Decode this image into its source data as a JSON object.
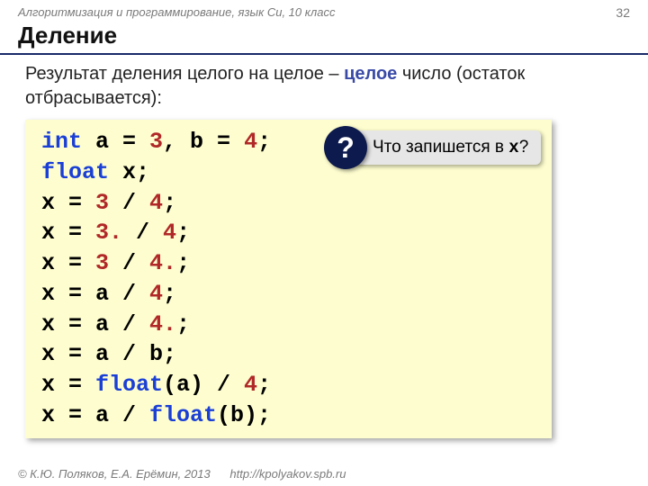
{
  "header": {
    "course": "Алгоритмизация и программирование, язык Си, 10 класс",
    "page": "32"
  },
  "title": "Деление",
  "description": {
    "pre": "Результат деления целого на целое – ",
    "em": "целое",
    "post": " число (остаток отбрасывается):"
  },
  "code": {
    "l1_kw": "int",
    "l1_a": " a = ",
    "l1_n1": "3",
    "l1_c": ", b = ",
    "l1_n2": "4",
    "l1_e": ";",
    "l2_kw": "float",
    "l2_r": " x;",
    "l3_a": "x = ",
    "l3_n1": "3",
    "l3_m": " / ",
    "l3_n2": "4",
    "l3_e": ";",
    "l4_a": "x = ",
    "l4_n1": "3.",
    "l4_m": " / ",
    "l4_n2": "4",
    "l4_e": ";",
    "l5_a": "x = ",
    "l5_n1": "3",
    "l5_m": " / ",
    "l5_n2": "4.",
    "l5_e": ";",
    "l6_a": "x = a / ",
    "l6_n": "4",
    "l6_e": ";",
    "l7_a": "x = a / ",
    "l7_n": "4.",
    "l7_e": ";",
    "l8": "x = a / b;",
    "l9_a": "x = ",
    "l9_f": "float",
    "l9_b": "(a) / ",
    "l9_n": "4",
    "l9_e": ";",
    "l10_a": "x = a / ",
    "l10_f": "float",
    "l10_b": "(b);"
  },
  "callout": {
    "mark": "?",
    "text_pre": "Что запишется в ",
    "var": "x",
    "text_post": "?"
  },
  "footer": {
    "copyright": "© К.Ю. Поляков, Е.А. Ерёмин, 2013",
    "url": "http://kpolyakov.spb.ru"
  }
}
